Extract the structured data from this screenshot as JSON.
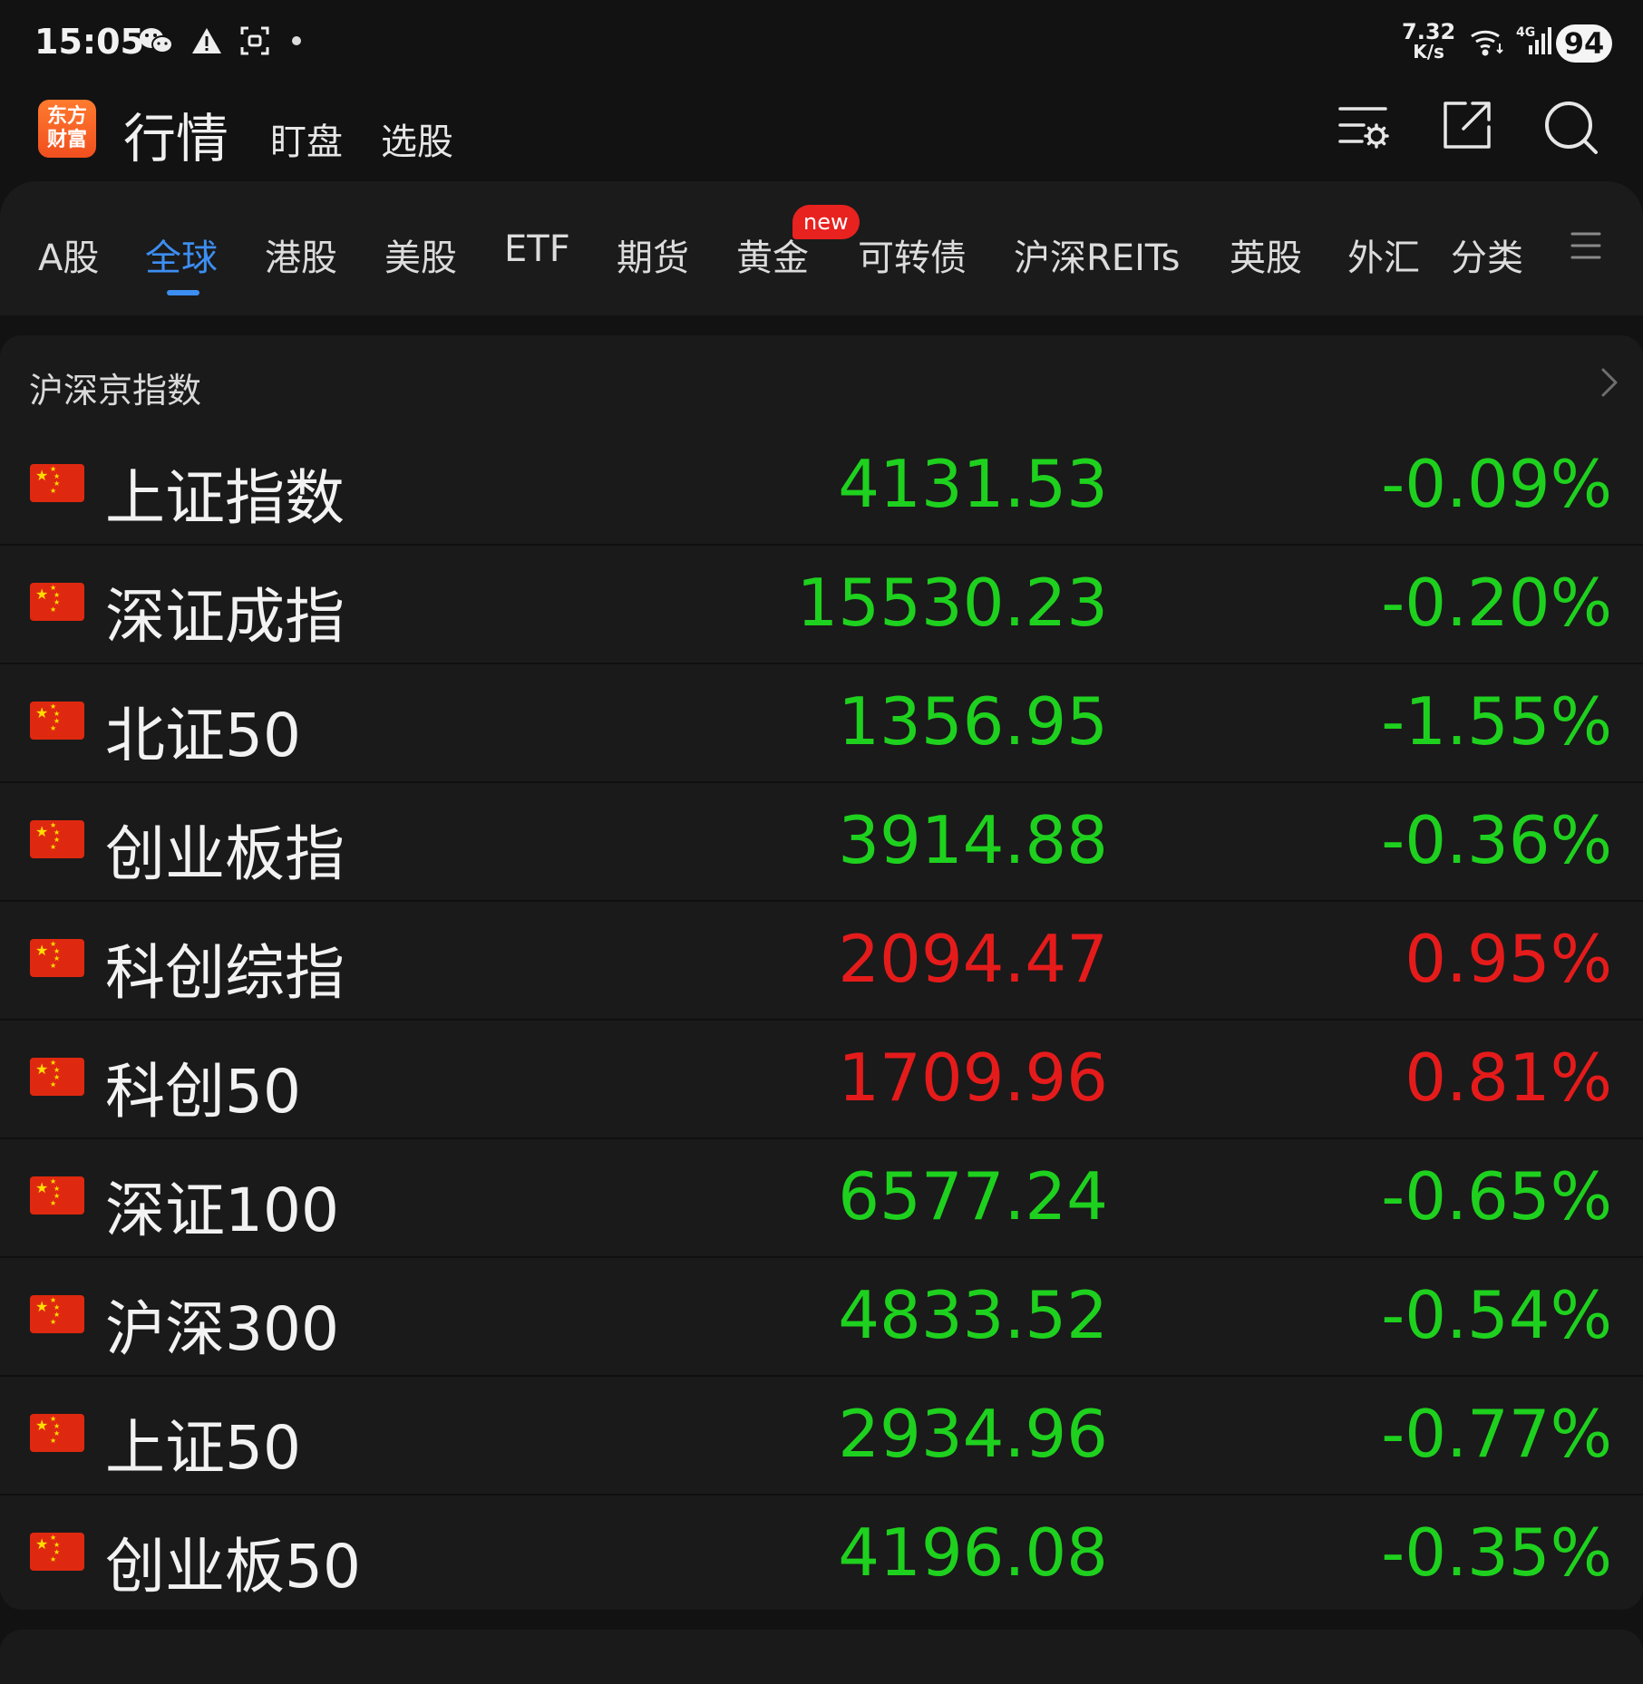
{
  "status_bar": {
    "time": "15:05",
    "net_speed_value": "7.32",
    "net_speed_unit": "K/s",
    "signal_label": "4G",
    "battery": "94",
    "icons": [
      "wechat-icon",
      "warning-icon",
      "screenshot-icon",
      "dot-icon",
      "wifi-icon",
      "signal-icon",
      "battery-icon"
    ]
  },
  "app_bar": {
    "logo_text_line1": "东方",
    "logo_text_line2": "财富",
    "title": "行情",
    "tabs": [
      "盯盘",
      "选股"
    ],
    "icons": [
      "list-settings-icon",
      "share-icon",
      "search-icon"
    ]
  },
  "market_tabs": {
    "items": [
      "A股",
      "全球",
      "港股",
      "美股",
      "ETF",
      "期货",
      "黄金",
      "可转债",
      "沪深REITs",
      "英股",
      "外汇",
      "分类"
    ],
    "active": "全球",
    "badge": "new",
    "badge_on": "黄金",
    "accent_color": "#3d8ef2"
  },
  "section": {
    "title": "沪深京指数",
    "colors": {
      "down": "#1ed11e",
      "up": "#e51b1b"
    },
    "rows": [
      {
        "name": "上证指数",
        "price": "4131.53",
        "change": "-0.09%",
        "direction": "down"
      },
      {
        "name": "深证成指",
        "price": "15530.23",
        "change": "-0.20%",
        "direction": "down"
      },
      {
        "name": "北证50",
        "price": "1356.95",
        "change": "-1.55%",
        "direction": "down"
      },
      {
        "name": "创业板指",
        "price": "3914.88",
        "change": "-0.36%",
        "direction": "down"
      },
      {
        "name": "科创综指",
        "price": "2094.47",
        "change": "0.95%",
        "direction": "up"
      },
      {
        "name": "科创50",
        "price": "1709.96",
        "change": "0.81%",
        "direction": "up"
      },
      {
        "name": "深证100",
        "price": "6577.24",
        "change": "-0.65%",
        "direction": "down"
      },
      {
        "name": "沪深300",
        "price": "4833.52",
        "change": "-0.54%",
        "direction": "down"
      },
      {
        "name": "上证50",
        "price": "2934.96",
        "change": "-0.77%",
        "direction": "down"
      },
      {
        "name": "创业板50",
        "price": "4196.08",
        "change": "-0.35%",
        "direction": "down"
      }
    ]
  }
}
